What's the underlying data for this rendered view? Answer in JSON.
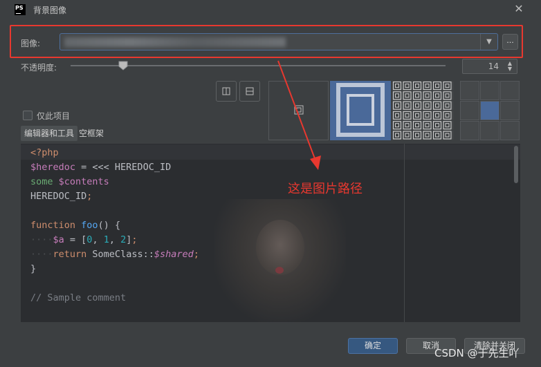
{
  "dialog": {
    "title": "背景图像",
    "app_icon_text": "PS",
    "close_glyph": "✕"
  },
  "image_field": {
    "label": "图像:",
    "value_redacted": true,
    "dropdown_glyph": "▼",
    "browse_label": "..."
  },
  "opacity": {
    "label": "不透明度:",
    "slider_level": 0.14,
    "value": "14"
  },
  "checkbox": {
    "label": "仅此项目",
    "checked": false
  },
  "tabs": [
    {
      "label": "编辑器和工具",
      "active": true
    },
    {
      "label": "空框架",
      "active": false
    }
  ],
  "code_lines": [
    "<?php",
    "$heredoc = <<< HEREDOC_ID",
    "some $contents",
    "HEREDOC_ID;",
    "",
    "function foo() {",
    "    $a = [0, 1, 2];",
    "    return SomeClass::$shared;",
    "}",
    "",
    "// Sample comment"
  ],
  "annotation": {
    "text": "这是图片路径",
    "color": "#e8382f"
  },
  "buttons": {
    "ok": "确定",
    "cancel": "取消",
    "clear_close": "清除并关闭"
  },
  "watermark": "CSDN @于先生吖",
  "colors": {
    "accent": "#4a6999",
    "primary_button": "#365880",
    "highlight_red": "#e8382f"
  }
}
